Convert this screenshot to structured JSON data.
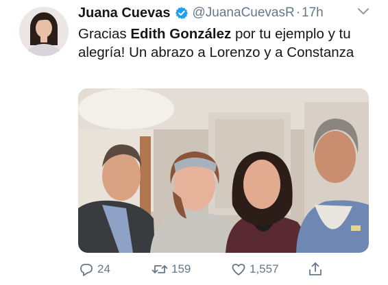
{
  "tweet": {
    "author": {
      "display_name": "Juana Cuevas",
      "handle": "@JuanaCuevasR",
      "verified": true,
      "avatar_icon": "profile-photo"
    },
    "separator": "·",
    "timestamp": "17h",
    "menu_icon": "chevron-down-icon",
    "text": {
      "part1": "Gracias ",
      "mention_bold": "Edith González",
      "part2": " por tu ejemplo y tu alegría! Un abrazo a Lorenzo y a Constanza"
    },
    "media": {
      "type": "photo"
    },
    "actions": {
      "reply_count": "24",
      "retweet_count": "159",
      "like_count": "1,557"
    }
  },
  "colors": {
    "text": "#14171a",
    "secondary": "#657786",
    "verified_blue": "#1da1f2"
  }
}
